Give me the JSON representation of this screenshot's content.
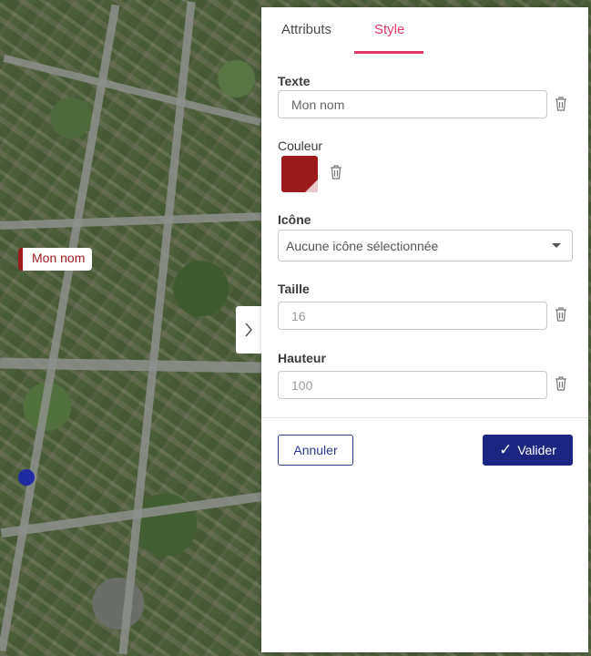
{
  "map": {
    "marker_label": "Mon nom",
    "marker_color": "#9b1a1a",
    "dot_color": "#1f2aa3",
    "toggle_icon": "chevron-right-icon"
  },
  "tabs": [
    {
      "label": "Attributs",
      "active": false
    },
    {
      "label": "Style",
      "active": true
    }
  ],
  "accent_color": "#e03a66",
  "form": {
    "text": {
      "label": "Texte",
      "value": "Mon nom"
    },
    "color": {
      "label": "Couleur",
      "value": "#9b1a1a"
    },
    "icon": {
      "label": "Icône",
      "selected": "Aucune icône sélectionnée"
    },
    "size": {
      "label": "Taille",
      "placeholder": "16"
    },
    "height": {
      "label": "Hauteur",
      "placeholder": "100"
    }
  },
  "actions": {
    "cancel_label": "Annuler",
    "submit_label": "Valider",
    "submit_icon": "check-icon",
    "submit_color": "#1c2680"
  }
}
